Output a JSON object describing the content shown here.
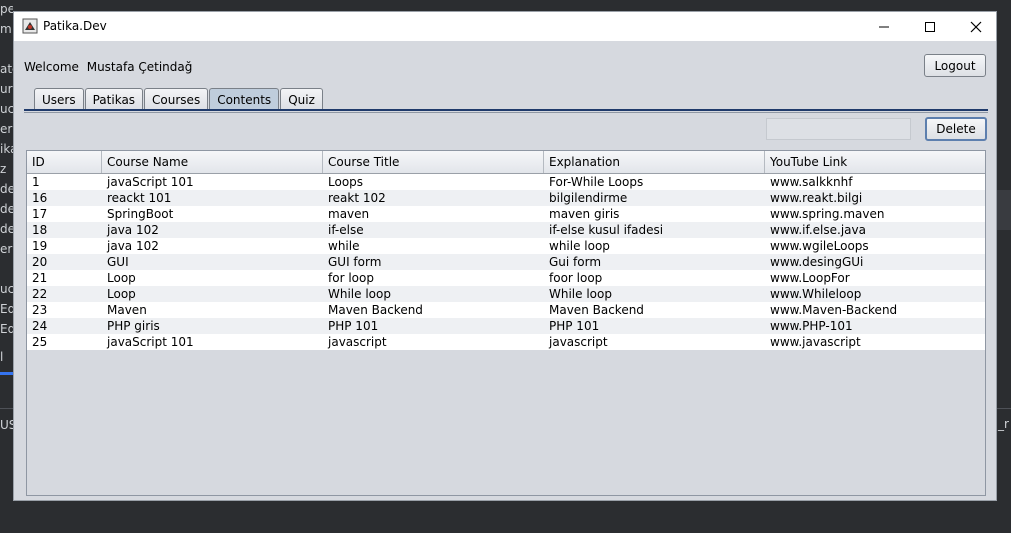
{
  "window": {
    "title": "Patika.Dev"
  },
  "header": {
    "welcome_label": "Welcome",
    "user_name": "Mustafa Çetindağ",
    "logout_label": "Logout"
  },
  "tabs": [
    {
      "label": "Users",
      "active": false
    },
    {
      "label": "Patikas",
      "active": false
    },
    {
      "label": "Courses",
      "active": false
    },
    {
      "label": "Contents",
      "active": true
    },
    {
      "label": "Quiz",
      "active": false
    }
  ],
  "toolbar": {
    "search_value": "",
    "delete_label": "Delete"
  },
  "table": {
    "columns": [
      "ID",
      "Course Name",
      "Course Title",
      "Explanation",
      "YouTube Link"
    ],
    "rows": [
      [
        "1",
        "javaScript 101",
        "Loops",
        "For-While Loops",
        "www.salkknhf"
      ],
      [
        "16",
        "reackt 101",
        "reakt 102",
        "bilgilendirme",
        "www.reakt.bilgi"
      ],
      [
        "17",
        "SpringBoot",
        "maven",
        "maven giris",
        "www.spring.maven"
      ],
      [
        "18",
        "java 102",
        "if-else",
        "if-else kusul ifadesi",
        "www.if.else.java"
      ],
      [
        "19",
        "java 102",
        "while",
        "while loop",
        "www.wgileLoops"
      ],
      [
        "20",
        "GUI",
        "GUI form",
        "Gui form",
        "www.desingGUi"
      ],
      [
        "21",
        "Loop",
        "for loop",
        "foor loop",
        "www.LoopFor"
      ],
      [
        "22",
        "Loop",
        "While loop",
        "While loop",
        "www.Whileloop"
      ],
      [
        "23",
        "Maven",
        "Maven Backend",
        "Maven Backend",
        "www.Maven-Backend"
      ],
      [
        "24",
        "PHP giris",
        "PHP 101",
        "PHP 101",
        "www.PHP-101"
      ],
      [
        "25",
        "javaScript 101",
        "javascript",
        "javascript",
        "www.javascript"
      ]
    ]
  },
  "background": {
    "left_fragments": [
      "per",
      "m",
      "ate",
      "urs",
      "uca",
      "era",
      "ika",
      "z",
      "de",
      "de",
      "de",
      "er",
      "uca",
      "Ed",
      "Ed",
      "l",
      "US"
    ],
    "right_fragment": "_r"
  },
  "colors": {
    "accent": "#1f3a6b",
    "active_tab": "#bfcddc",
    "window_bg": "#d6d9df"
  }
}
